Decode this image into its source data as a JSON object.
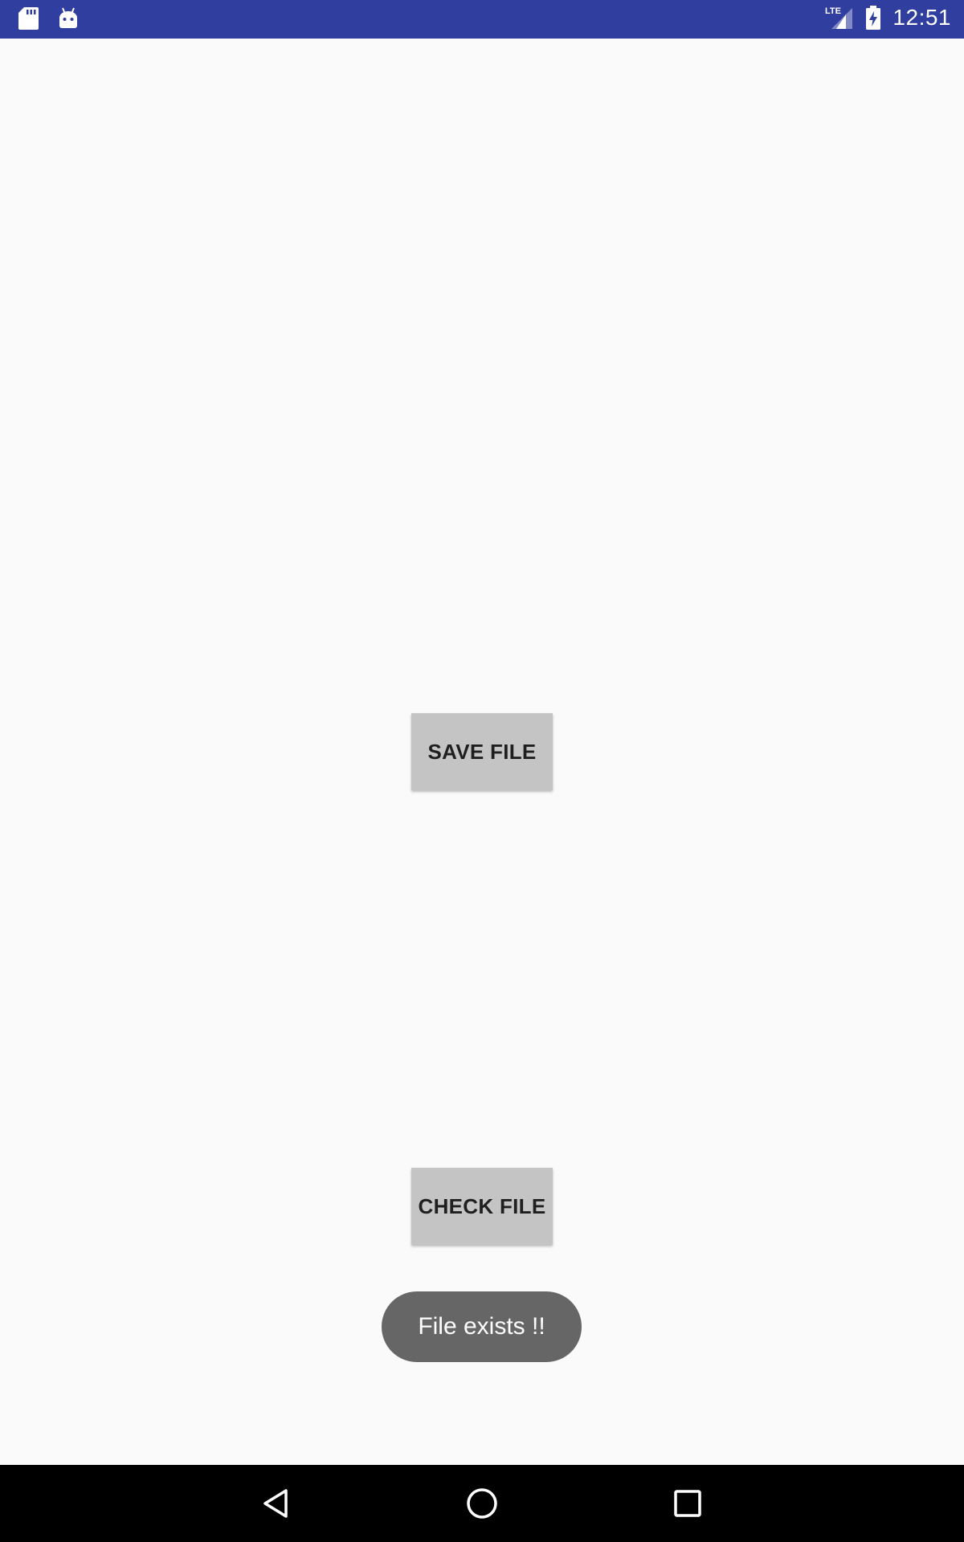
{
  "status_bar": {
    "time": "12:51",
    "network": "LTE",
    "icons": [
      "sd-card-icon",
      "android-debug-icon",
      "lte-signal-icon",
      "battery-charging-icon"
    ],
    "background_color": "#303f9f"
  },
  "main": {
    "save_button_label": "SAVE FILE",
    "check_button_label": "CHECK FILE",
    "button_color": "#c4c4c4",
    "background_color": "#fafafa"
  },
  "toast": {
    "message": "File exists !!",
    "background_color": "#666666"
  },
  "nav_bar": {
    "icons": [
      "back-icon",
      "home-icon",
      "recents-icon"
    ],
    "background_color": "#000000"
  }
}
